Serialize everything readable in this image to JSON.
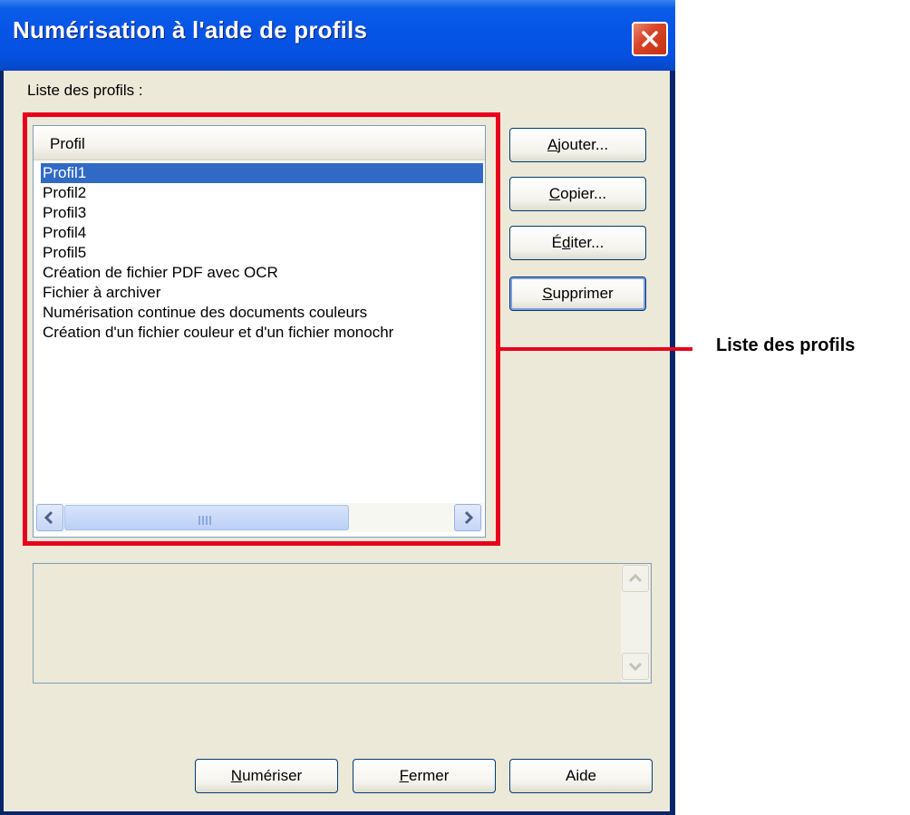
{
  "window": {
    "title": "Numérisation à l'aide de profils",
    "close_icon": "close-icon"
  },
  "profile_list": {
    "label": "Liste des profils :",
    "column_header": "Profil",
    "items": [
      "Profil1",
      "Profil2",
      "Profil3",
      "Profil4",
      "Profil5",
      "Création de fichier PDF avec OCR",
      "Fichier à archiver",
      "Numérisation continue des documents couleurs",
      "Création d'un fichier couleur et d'un fichier monochr"
    ],
    "selected_item": "Profil1"
  },
  "side_buttons": {
    "add": {
      "mnemonic": "A",
      "rest": "jouter..."
    },
    "copy": {
      "mnemonic": "C",
      "rest": "opier..."
    },
    "edit": {
      "pre": "É",
      "mnemonic": "d",
      "rest": "iter..."
    },
    "delete": {
      "mnemonic": "S",
      "rest": "upprimer"
    }
  },
  "bottom_buttons": {
    "scan": {
      "mnemonic": "N",
      "rest": "umériser"
    },
    "close": {
      "mnemonic": "F",
      "rest": "ermer"
    },
    "help": "Aide"
  },
  "annotation": {
    "text": "Liste des profils",
    "color": "#e8001c"
  },
  "colors": {
    "title_bar": "#0654e6",
    "selection": "#316ac5",
    "dialog_bg": "#ece9d8"
  }
}
